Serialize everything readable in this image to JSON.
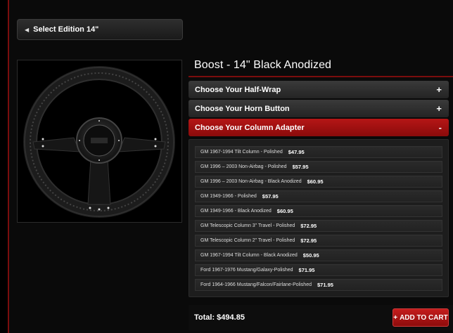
{
  "back_button": {
    "label": "Select Edition 14\""
  },
  "product": {
    "title": "Boost - 14\" Black Anodized"
  },
  "accordion": [
    {
      "label": "Choose Your Half-Wrap",
      "symbol": "+"
    },
    {
      "label": "Choose Your Horn Button",
      "symbol": "+"
    },
    {
      "label": "Choose Your Column Adapter",
      "symbol": "-"
    }
  ],
  "options": [
    {
      "name": "GM 1967-1994 Tilt Column - Polished",
      "price": "$47.95"
    },
    {
      "name": "GM 1996 – 2003 Non-Airbag - Polished",
      "price": "$57.95"
    },
    {
      "name": "GM 1996 – 2003 Non-Airbag - Black Anodized",
      "price": "$60.95"
    },
    {
      "name": "GM 1949-1966 - Polished",
      "price": "$57.95"
    },
    {
      "name": "GM 1949-1966 - Black Anodized",
      "price": "$60.95"
    },
    {
      "name": "GM Telescopic Column 3\" Travel - Polished",
      "price": "$72.95"
    },
    {
      "name": "GM Telescopic Column 2\" Travel - Polished",
      "price": "$72.95"
    },
    {
      "name": "GM 1967-1994 Tilt Column - Black Anodized",
      "price": "$50.95"
    },
    {
      "name": "Ford 1967-1976 Mustang/Galaxy-Polished",
      "price": "$71.95"
    },
    {
      "name": "Ford 1964-1966 Mustang/Falcon/Fairlane-Polished",
      "price": "$71.95"
    }
  ],
  "footer": {
    "total": "Total: $494.85",
    "cart_label": "ADD TO CART",
    "cart_symbol": "+"
  },
  "colors": {
    "accent_red": "#b51616",
    "background": "#0a0a0a"
  }
}
